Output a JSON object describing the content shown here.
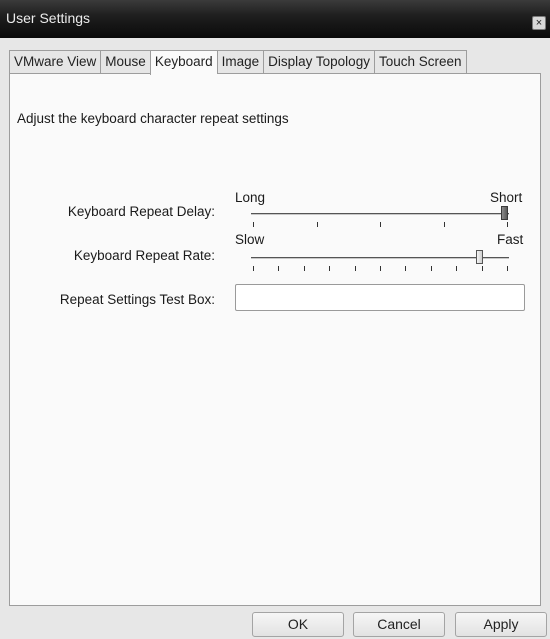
{
  "window": {
    "title": "User Settings",
    "close_label": "×"
  },
  "tabs": [
    {
      "label": "VMware View"
    },
    {
      "label": "Mouse"
    },
    {
      "label": "Keyboard",
      "active": true
    },
    {
      "label": "Image"
    },
    {
      "label": "Display Topology"
    },
    {
      "label": "Touch Screen"
    }
  ],
  "keyboard": {
    "description": "Adjust the keyboard character repeat settings",
    "repeat_delay": {
      "label": "Keyboard Repeat Delay:",
      "min_label": "Long",
      "max_label": "Short",
      "tick_count": 5,
      "value_fraction": 1.0
    },
    "repeat_rate": {
      "label": "Keyboard Repeat Rate:",
      "min_label": "Slow",
      "max_label": "Fast",
      "tick_count": 11,
      "value_fraction": 0.9
    },
    "test_box": {
      "label": "Repeat Settings Test Box:",
      "value": ""
    }
  },
  "buttons": {
    "ok": "OK",
    "cancel": "Cancel",
    "apply": "Apply"
  },
  "colors": {
    "titlebar": "#111111",
    "panel": "#fafafa",
    "window_bg": "#e7e7e7"
  }
}
